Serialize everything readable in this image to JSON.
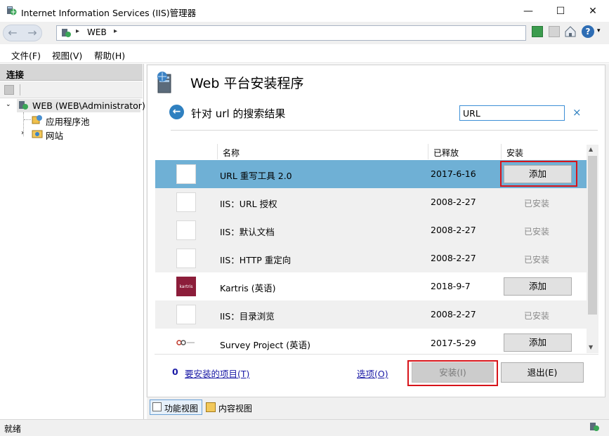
{
  "window": {
    "title": "Internet Information Services (IIS)管理器",
    "controls": {
      "minimize": "—",
      "maximize": "☐",
      "close": "✕"
    }
  },
  "address": {
    "crumb": "WEB",
    "sep1": "▸",
    "sep2": "▸"
  },
  "menu": {
    "file": "文件(F)",
    "view": "视图(V)",
    "help": "帮助(H)"
  },
  "connections": {
    "header": "连接",
    "tree": [
      {
        "label": "WEB (WEB\\Administrator)"
      },
      {
        "label": "应用程序池"
      },
      {
        "label": "网站"
      }
    ]
  },
  "main": {
    "title": "Web 平台安装程序",
    "subtitle": "针对 url 的搜索结果",
    "search_value": "URL",
    "search_clear": "×",
    "columns": {
      "name": "名称",
      "released": "已释放",
      "install": "安装"
    },
    "rows": [
      {
        "name": "URL 重写工具 2.0",
        "date": "2017-6-16",
        "action": "添加"
      },
      {
        "name": "IIS：URL 授权",
        "date": "2008-2-27",
        "action": "已安装"
      },
      {
        "name": "IIS：默认文档",
        "date": "2008-2-27",
        "action": "已安装"
      },
      {
        "name": "IIS：HTTP 重定向",
        "date": "2008-2-27",
        "action": "已安装"
      },
      {
        "name": "Kartris (英语)",
        "date": "2018-9-7",
        "action": "添加"
      },
      {
        "name": "IIS：目录浏览",
        "date": "2008-2-27",
        "action": "已安装"
      },
      {
        "name": "Survey Project (英语)",
        "date": "2017-5-29",
        "action": "添加"
      }
    ],
    "kartris_logo_text": "kartris",
    "pending_count": "0",
    "pending_link": "要安装的项目(T)",
    "options_link": "选项(O)",
    "install_button": "安装(I)",
    "exit_button": "退出(E)"
  },
  "view_tabs": {
    "features": "功能视图",
    "content": "内容视图"
  },
  "status": {
    "text": "就绪"
  },
  "colors": {
    "selected_row": "#6fb0d5",
    "alt_row": "#f0f0f0",
    "highlight_box": "#d7141a",
    "link": "#1a1aa6",
    "back_circle": "#2f80c0"
  }
}
